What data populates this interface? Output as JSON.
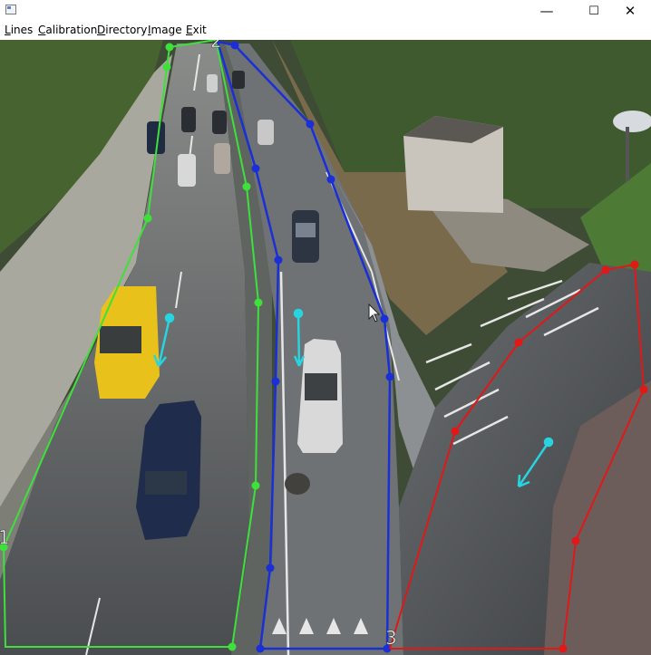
{
  "window": {
    "minimize_glyph": "—",
    "maximize_glyph": "☐",
    "close_glyph": "✕"
  },
  "menu": [
    {
      "mnemonic": "L",
      "rest": "ines"
    },
    {
      "mnemonic": "C",
      "rest": "alibration"
    },
    {
      "mnemonic": "D",
      "rest": "irectory"
    },
    {
      "mnemonic": "I",
      "rest": "mage"
    },
    {
      "mnemonic": "E",
      "rest": "xit"
    }
  ],
  "regions": [
    {
      "label": "1",
      "color": "#3ee03b"
    },
    {
      "label": "2",
      "color": "#1a2fd6"
    },
    {
      "label": "3",
      "color": "#e01818"
    }
  ],
  "direction_arrow_color": "#27d4e0",
  "icons": {
    "app": "app-window-icon",
    "cursor": "mouse-pointer-icon"
  }
}
